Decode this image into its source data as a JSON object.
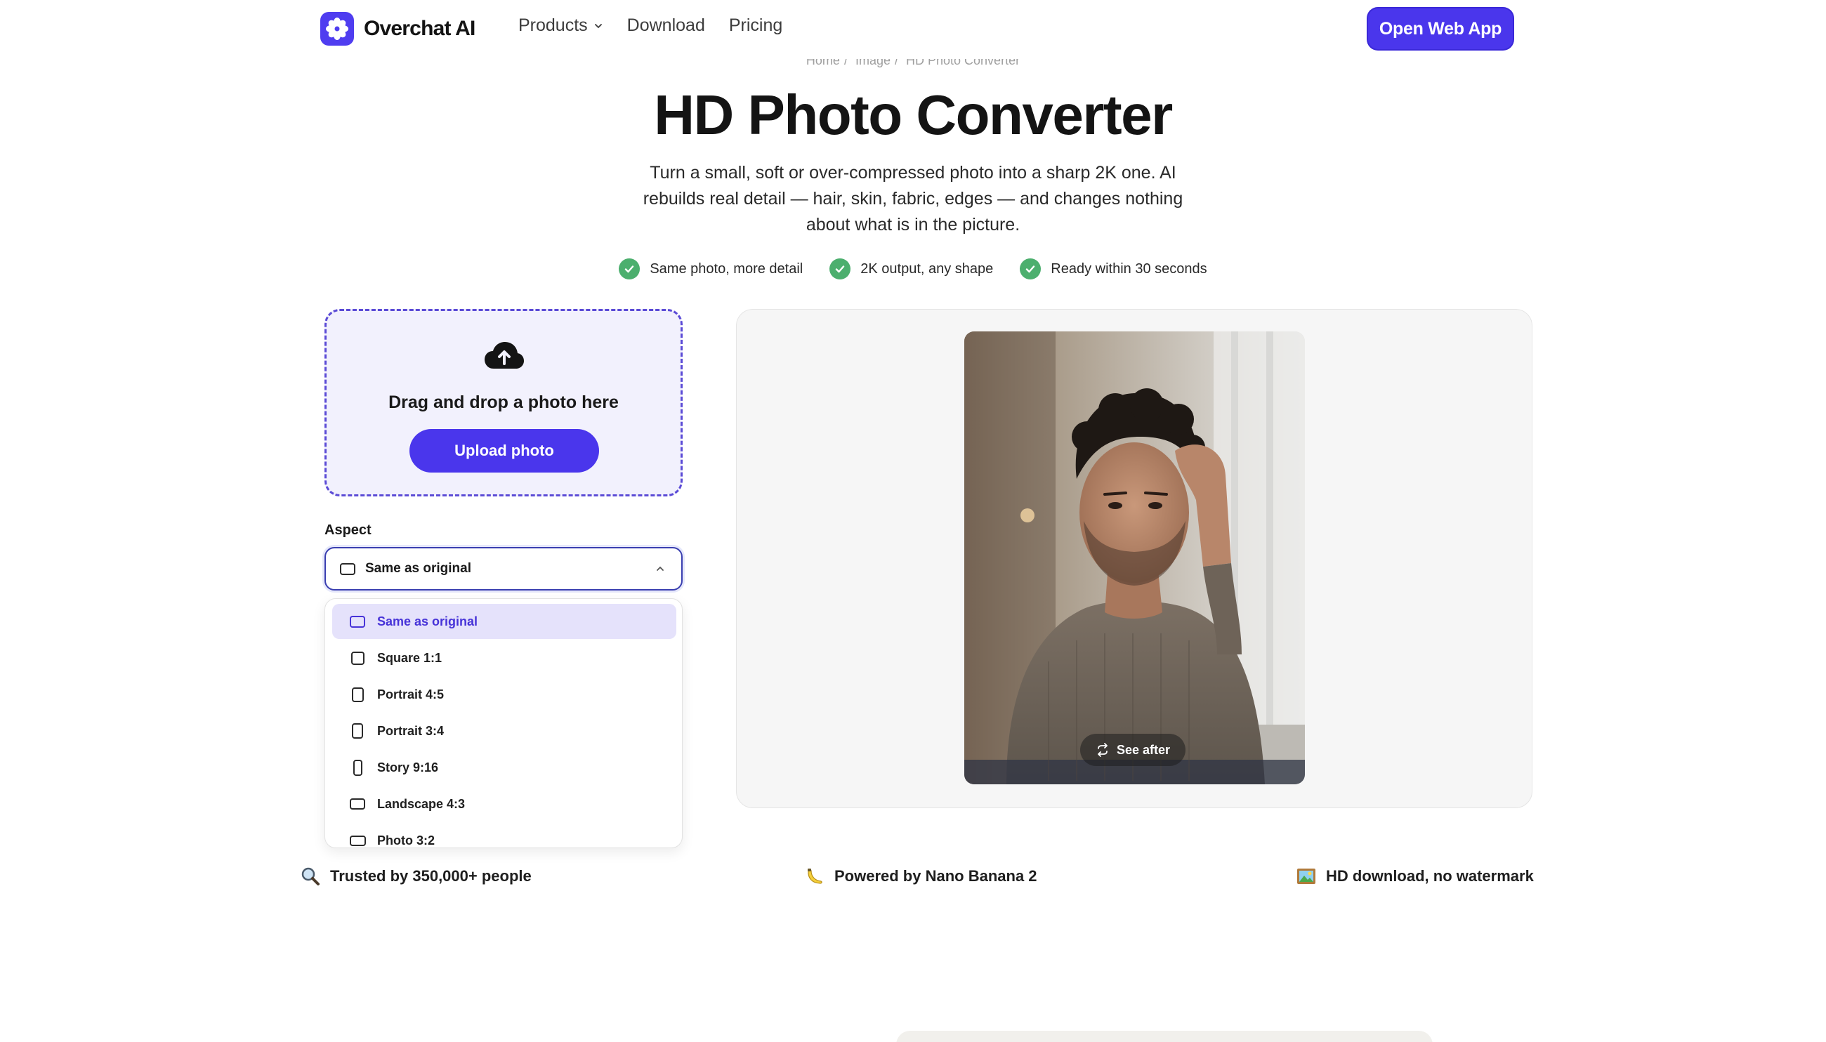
{
  "header": {
    "brand": "Overchat AI",
    "nav": [
      {
        "label": "Products",
        "has_dropdown": true
      },
      {
        "label": "Download"
      },
      {
        "label": "Pricing"
      }
    ],
    "cta": "Open Web App"
  },
  "breadcrumb": [
    "Home",
    "Image",
    "HD Photo Converter"
  ],
  "hero": {
    "title": "HD Photo Converter",
    "subtitle": "Turn a small, soft or over-compressed photo into a sharp 2K one. AI rebuilds real detail — hair, skin, fabric, edges — and changes nothing about what is in the picture.",
    "features": [
      "Same photo, more detail",
      "2K output, any shape",
      "Ready within 30 seconds"
    ]
  },
  "upload": {
    "drop_text": "Drag and drop a photo here",
    "button": "Upload photo"
  },
  "aspect": {
    "label": "Aspect",
    "selected": "Same as original",
    "options": [
      "Same as original",
      "Square 1:1",
      "Portrait 4:5",
      "Portrait 3:4",
      "Story 9:16",
      "Landscape 4:3",
      "Photo 3:2"
    ]
  },
  "preview": {
    "toggle_label": "See after"
  },
  "trust": [
    {
      "icon": "magnifier-icon",
      "text": "Trusted by 350,000+ people"
    },
    {
      "icon": "banana-icon",
      "text": "Powered by Nano Banana 2"
    },
    {
      "icon": "framed-picture-icon",
      "text": "HD download, no watermark"
    }
  ],
  "colors": {
    "accent": "#4a36ec",
    "check_green": "#4caf6e",
    "selected_bg": "#e5e2fb"
  }
}
